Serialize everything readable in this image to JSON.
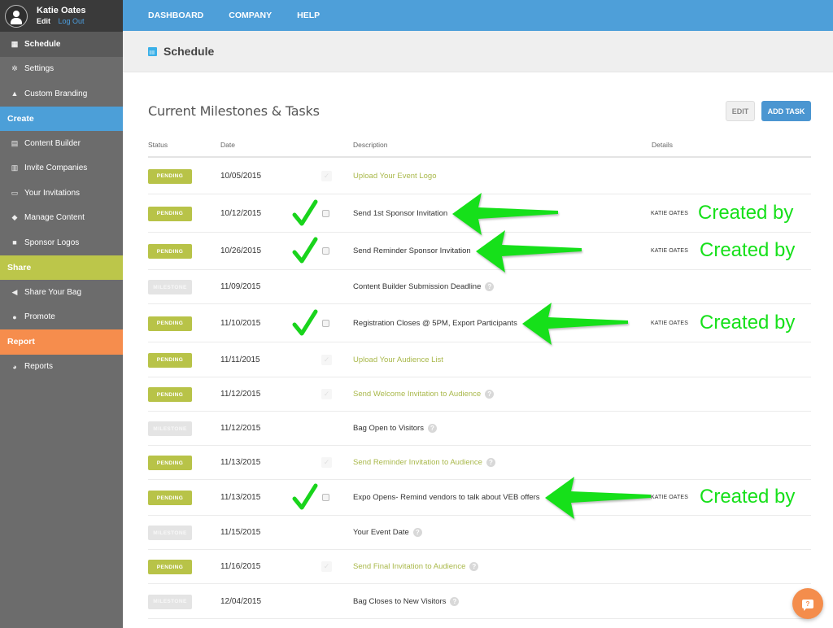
{
  "user": {
    "name": "Katie Oates",
    "edit_label": "Edit",
    "logout_label": "Log Out"
  },
  "sidebar": {
    "items_top": [
      {
        "label": "Schedule",
        "icon": "calendar-icon",
        "active": true
      },
      {
        "label": "Settings",
        "icon": "gear-icon",
        "active": false
      },
      {
        "label": "Custom Branding",
        "icon": "flask-icon",
        "active": false
      }
    ],
    "sections": [
      {
        "label": "Create",
        "color": "#4c9fd8",
        "items": [
          {
            "label": "Content Builder",
            "icon": "layout-icon"
          },
          {
            "label": "Invite Companies",
            "icon": "building-icon"
          },
          {
            "label": "Your Invitations",
            "icon": "inbox-icon"
          },
          {
            "label": "Manage Content",
            "icon": "tag-icon"
          },
          {
            "label": "Sponsor Logos",
            "icon": "briefcase-icon"
          }
        ]
      },
      {
        "label": "Share",
        "color": "#bcc64a",
        "items": [
          {
            "label": "Share Your Bag",
            "icon": "send-icon"
          },
          {
            "label": "Promote",
            "icon": "globe-icon"
          }
        ]
      },
      {
        "label": "Report",
        "color": "#f68d4d",
        "items": [
          {
            "label": "Reports",
            "icon": "pie-chart-icon"
          }
        ]
      }
    ]
  },
  "topnav": {
    "items": [
      "DASHBOARD",
      "COMPANY",
      "HELP"
    ]
  },
  "page": {
    "title": "Schedule"
  },
  "main": {
    "section_title": "Current Milestones & Tasks",
    "edit_label": "EDIT",
    "add_task_label": "ADD TASK",
    "columns": {
      "status": "Status",
      "date": "Date",
      "description": "Description",
      "details": "Details"
    },
    "rows": [
      {
        "status": "PENDING",
        "type": "pending",
        "date": "10/05/2015",
        "check": "disabled",
        "description": "Upload Your Event Logo",
        "link": true,
        "help": false,
        "creator": ""
      },
      {
        "status": "PENDING",
        "type": "pending",
        "date": "10/12/2015",
        "check": "box",
        "description": "Send 1st Sponsor Invitation",
        "link": false,
        "help": false,
        "creator": "KATIE OATES",
        "annotated": true
      },
      {
        "status": "PENDING",
        "type": "pending",
        "date": "10/26/2015",
        "check": "box",
        "description": "Send Reminder Sponsor Invitation",
        "link": false,
        "help": false,
        "creator": "KATIE OATES",
        "annotated": true
      },
      {
        "status": "MILESTONE",
        "type": "milestone",
        "date": "11/09/2015",
        "check": "none",
        "description": "Content Builder Submission Deadline",
        "link": false,
        "help": true,
        "creator": ""
      },
      {
        "status": "PENDING",
        "type": "pending",
        "date": "11/10/2015",
        "check": "box",
        "description": "Registration Closes @ 5PM, Export Participants",
        "link": false,
        "help": false,
        "creator": "KATIE OATES",
        "annotated": true
      },
      {
        "status": "PENDING",
        "type": "pending",
        "date": "11/11/2015",
        "check": "disabled",
        "description": "Upload Your Audience List",
        "link": true,
        "help": false,
        "creator": ""
      },
      {
        "status": "PENDING",
        "type": "pending",
        "date": "11/12/2015",
        "check": "disabled",
        "description": "Send Welcome Invitation to Audience",
        "link": true,
        "help": true,
        "creator": ""
      },
      {
        "status": "MILESTONE",
        "type": "milestone",
        "date": "11/12/2015",
        "check": "none",
        "description": "Bag Open to Visitors",
        "link": false,
        "help": true,
        "creator": ""
      },
      {
        "status": "PENDING",
        "type": "pending",
        "date": "11/13/2015",
        "check": "disabled",
        "description": "Send Reminder Invitation to Audience",
        "link": true,
        "help": true,
        "creator": ""
      },
      {
        "status": "PENDING",
        "type": "pending",
        "date": "11/13/2015",
        "check": "box",
        "description": "Expo Opens- Remind vendors to talk about VEB offers",
        "link": false,
        "help": false,
        "creator": "KATIE OATES",
        "annotated": true
      },
      {
        "status": "MILESTONE",
        "type": "milestone",
        "date": "11/15/2015",
        "check": "none",
        "description": "Your Event Date",
        "link": false,
        "help": true,
        "creator": ""
      },
      {
        "status": "PENDING",
        "type": "pending",
        "date": "11/16/2015",
        "check": "disabled",
        "description": "Send Final Invitation to Audience",
        "link": true,
        "help": true,
        "creator": ""
      },
      {
        "status": "MILESTONE",
        "type": "milestone",
        "date": "12/04/2015",
        "check": "none",
        "description": "Bag Closes to New Visitors",
        "link": false,
        "help": true,
        "creator": ""
      }
    ]
  },
  "annotations": {
    "label": "Created by",
    "color": "#16e01a"
  },
  "help_fab": {
    "glyph": "?"
  },
  "colors": {
    "pending": "#b8c348",
    "milestone": "#e4e4e4",
    "accent": "#4e9fd9",
    "link": "#a9b84a"
  }
}
